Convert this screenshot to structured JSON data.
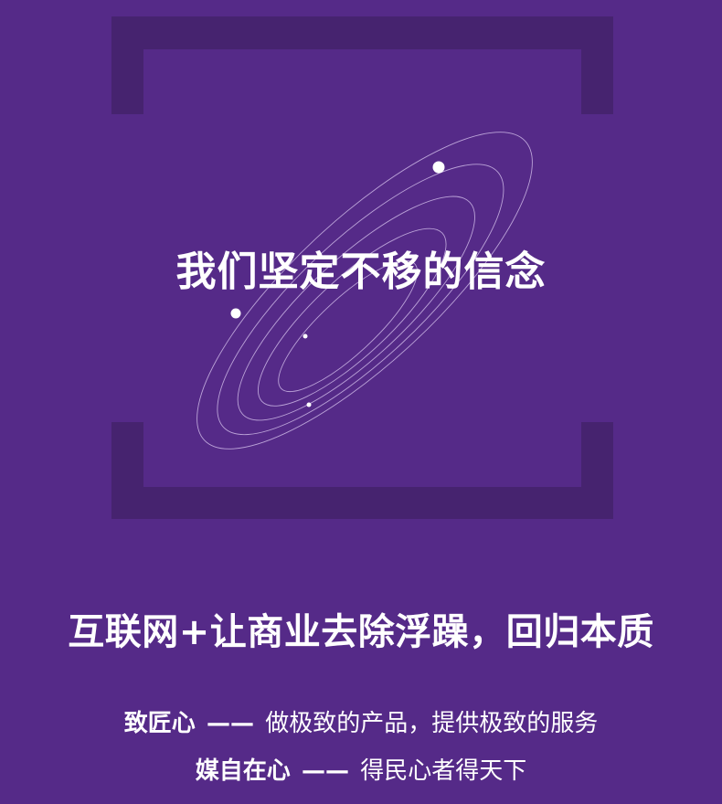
{
  "hero": {
    "title": "我们坚定不移的信念"
  },
  "slogan": {
    "text": "互联网+让商业去除浮躁，回归本质"
  },
  "mottos": [
    {
      "key": "致匠心",
      "dash": "——",
      "text": "做极致的产品，提供极致的服务"
    },
    {
      "key": "媒自在心",
      "dash": "——",
      "text": "得民心者得天下"
    }
  ],
  "colors": {
    "background": "#552a88",
    "bracket": "#46236f",
    "text": "#ffffff"
  },
  "icons": {
    "decoration": "orbit-ellipses"
  }
}
